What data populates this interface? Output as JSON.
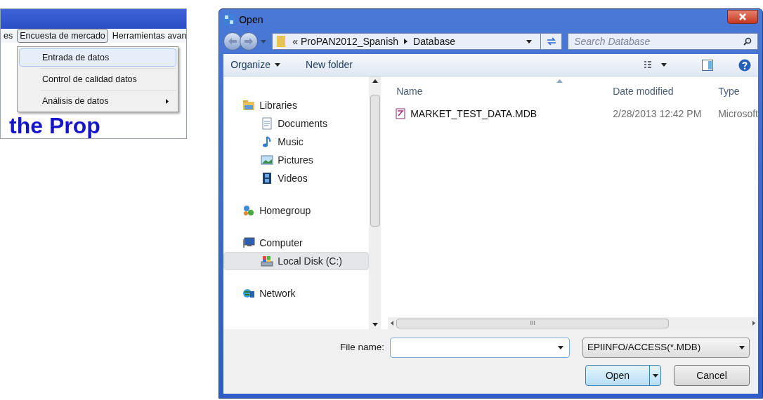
{
  "menu_window": {
    "menubar": [
      {
        "label": "es",
        "selected": false
      },
      {
        "label": "Encuesta de mercado",
        "selected": true
      },
      {
        "label": "Herramientas avan",
        "selected": false
      }
    ],
    "menu_items": [
      {
        "label": "Entrada de datos",
        "selected": true,
        "submenu": false
      },
      {
        "label": "Control de calidad datos",
        "selected": false,
        "submenu": false
      },
      {
        "label": "Análisis de datos",
        "selected": false,
        "submenu": true
      }
    ],
    "background_text": "the Prop"
  },
  "dialog": {
    "title": "Open",
    "path": [
      "ProPAN2012_Spanish",
      "Database"
    ],
    "path_overflow": "«",
    "search": {
      "placeholder": "Search Database"
    },
    "toolbar": {
      "organize": "Organize",
      "new_folder": "New folder"
    },
    "nav": [
      {
        "label": "Libraries",
        "kind": "libraries",
        "selected": false,
        "children": [
          {
            "label": "Documents",
            "kind": "documents",
            "selected": false
          },
          {
            "label": "Music",
            "kind": "music",
            "selected": false
          },
          {
            "label": "Pictures",
            "kind": "pictures",
            "selected": false
          },
          {
            "label": "Videos",
            "kind": "videos",
            "selected": false
          }
        ]
      },
      {
        "label": "Homegroup",
        "kind": "homegroup",
        "selected": false
      },
      {
        "label": "Computer",
        "kind": "computer",
        "selected": false,
        "children": [
          {
            "label": "Local Disk (C:)",
            "kind": "disk",
            "selected": true
          }
        ]
      },
      {
        "label": "Network",
        "kind": "network",
        "selected": false
      }
    ],
    "columns": [
      "Name",
      "Date modified",
      "Type"
    ],
    "files": [
      {
        "name": "MARKET_TEST_DATA.MDB",
        "date": "2/28/2013 12:42 PM",
        "type": "Microsoft"
      }
    ],
    "scroll_grip": "III",
    "file_name": {
      "label": "File name:"
    },
    "file_type": "EPIINFO/ACCESS(*.MDB)",
    "buttons": {
      "open": "Open",
      "cancel": "Cancel"
    }
  }
}
